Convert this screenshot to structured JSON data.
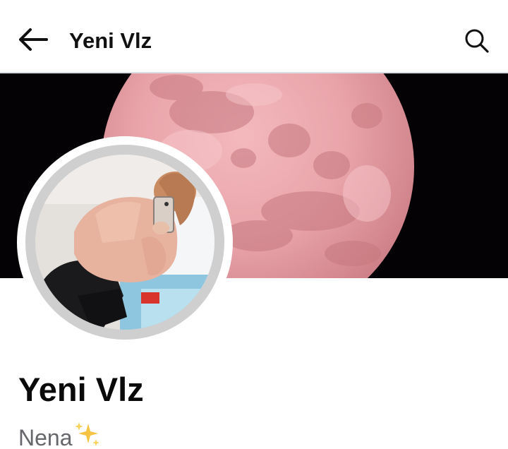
{
  "header": {
    "title": "Yeni Vlz",
    "back_icon": "arrow-left-icon",
    "search_icon": "search-icon"
  },
  "cover": {
    "description_icon": "pink-moon-cover-photo",
    "moon_color": "#e8a2a8",
    "sky_color": "#050206"
  },
  "profile": {
    "avatar_icon": "profile-photo",
    "name": "Yeni Vlz",
    "bio_text": "Nena",
    "bio_emoji": "sparkles-icon"
  },
  "colors": {
    "name_text": "#0a0a0a",
    "bio_text": "#65676b",
    "divider": "#dadde1"
  }
}
